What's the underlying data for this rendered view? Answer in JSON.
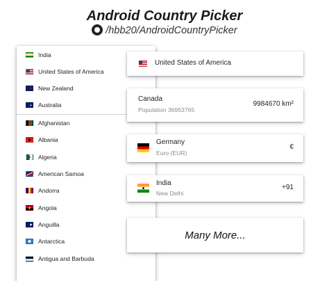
{
  "header": {
    "title": "Android Country Picker",
    "repo": "/hbb20/AndroidCountryPicker",
    "repo_icon": "github-icon"
  },
  "list": {
    "items": [
      {
        "name": "India",
        "flag": "flag-in"
      },
      {
        "name": "United States of America",
        "flag": "flag-us"
      },
      {
        "name": "New Zealand",
        "flag": "flag-nz"
      },
      {
        "name": "Australia",
        "flag": "flag-au"
      },
      {
        "name": "Afghanistan",
        "flag": "flag-af"
      },
      {
        "name": "Albania",
        "flag": "flag-al"
      },
      {
        "name": "Algeria",
        "flag": "flag-dz"
      },
      {
        "name": "American Samoa",
        "flag": "flag-as"
      },
      {
        "name": "Andorra",
        "flag": "flag-ad"
      },
      {
        "name": "Angola",
        "flag": "flag-ao"
      },
      {
        "name": "Anguilla",
        "flag": "flag-ai"
      },
      {
        "name": "Antarctica",
        "flag": "flag-aq"
      },
      {
        "name": "Antigua and Barbuda",
        "flag": "flag-ag"
      }
    ]
  },
  "cards": {
    "selected": {
      "name": "United States of America",
      "flag": "flag-us"
    },
    "canada": {
      "name": "Canada",
      "detail": "Population 36953765",
      "value": "9984670 km²"
    },
    "germany": {
      "name": "Germany",
      "detail": "Euro (EUR)",
      "value": "€",
      "flag": "flag-de"
    },
    "india": {
      "name": "India",
      "detail": "New Delhi",
      "value": "+91",
      "flag": "flag-in"
    },
    "more": {
      "label": "Many More..."
    }
  },
  "colors": {
    "card_bg": "#ffffff",
    "subtext": "#8a8a8a",
    "divider": "#d0d0d0"
  }
}
